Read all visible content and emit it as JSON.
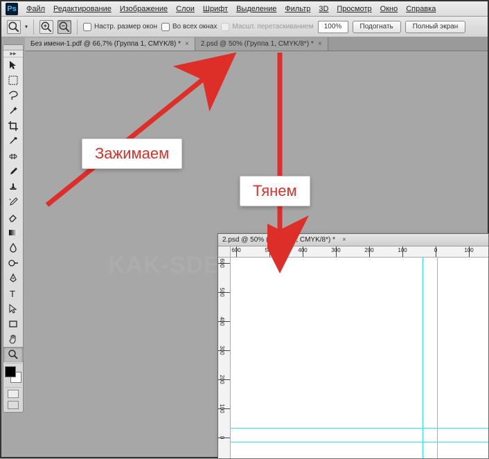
{
  "app": {
    "logo": "Ps"
  },
  "menu": {
    "file": "Файл",
    "edit": "Редактирование",
    "image": "Изображение",
    "layer": "Слои",
    "type": "Шрифт",
    "select": "Выделение",
    "filter": "Фильтр",
    "threeD": "3D",
    "view": "Просмотр",
    "window": "Окно",
    "help": "Справка"
  },
  "options": {
    "resize_windows": "Настр. размер окон",
    "all_windows": "Во всех окнах",
    "scrubby": "Масшт. перетаскиванием",
    "zoom_value": "100%",
    "fit": "Подогнать",
    "full": "Полный экран"
  },
  "tabs": [
    {
      "label": "Без имени-1.pdf @ 66,7% (Группа 1, CMYK/8) *"
    },
    {
      "label": "2.psd @ 50% (Группа 1, CMYK/8*) *"
    }
  ],
  "docwin": {
    "title": "2.psd @ 50% (Группа 1, CMYK/8*) *",
    "ruler_h": [
      "600",
      "500",
      "400",
      "300",
      "200",
      "100",
      "0",
      "100"
    ],
    "ruler_v": [
      "600",
      "500",
      "400",
      "300",
      "200",
      "100",
      "0"
    ]
  },
  "annotations": {
    "hold": "Зажимаем",
    "drag": "Тянем"
  },
  "watermark": "KAK-SDELAT.ORG"
}
